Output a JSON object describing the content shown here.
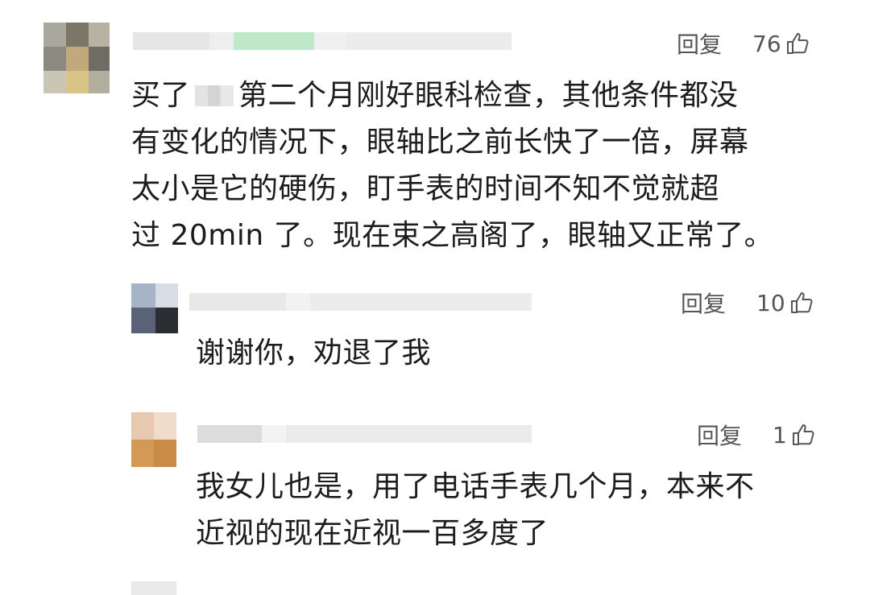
{
  "comments": [
    {
      "text_before_blur": "买了",
      "text_after_blur": "第二个月刚好眼科检查，其他条件都没\n有变化的情况下，眼轴比之前长快了一倍，屏幕\n太小是它的硬伤，盯手表的时间不知不觉就超\n过 20min 了。现在束之高阁了，眼轴又正常了。",
      "reply_label": "回复",
      "like_count": "76",
      "like_icon": "thumbs-up-icon"
    },
    {
      "text": "谢谢你，劝退了我",
      "reply_label": "回复",
      "like_count": "10",
      "like_icon": "thumbs-up-icon"
    },
    {
      "text": "我女儿也是，用了电话手表几个月，本来不\n近视的现在近视一百多度了",
      "reply_label": "回复",
      "like_count": "1",
      "like_icon": "thumbs-up-icon"
    }
  ],
  "colors": {
    "text": "#1c1c1c",
    "meta": "#555555"
  }
}
